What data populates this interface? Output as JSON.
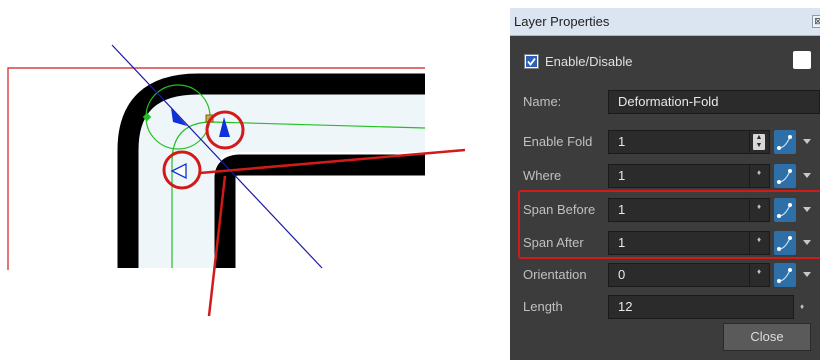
{
  "dialog": {
    "title": "Layer Properties",
    "title_close_glyph": "⊠",
    "enable_label": "Enable/Disable",
    "enable_checked": true,
    "name_label": "Name:",
    "name_value": "Deformation-Fold",
    "rows": {
      "enable_fold": {
        "label": "Enable Fold",
        "value": "1"
      },
      "where": {
        "label": "Where",
        "value": "1"
      },
      "span_before": {
        "label": "Span Before",
        "value": "1"
      },
      "span_after": {
        "label": "Span After",
        "value": "1"
      },
      "orientation": {
        "label": "Orientation",
        "value": "0"
      },
      "length": {
        "label": "Length",
        "value": "12"
      }
    },
    "close_label": "Close",
    "spinner_glyph": "♦",
    "highlight_color": "#d11a1a"
  },
  "canvas": {
    "stroke_color": "#000000",
    "fill_color": "#eff6f9",
    "deformer_color": "#22c022",
    "axis_color": "#1a1aa8",
    "callout_color": "#d11a1a",
    "handle_color": "#1030d8",
    "icons": [
      "fold-control-point-icon",
      "fold-handle-arrow-icon",
      "fold-orientation-arrow-icon"
    ]
  }
}
